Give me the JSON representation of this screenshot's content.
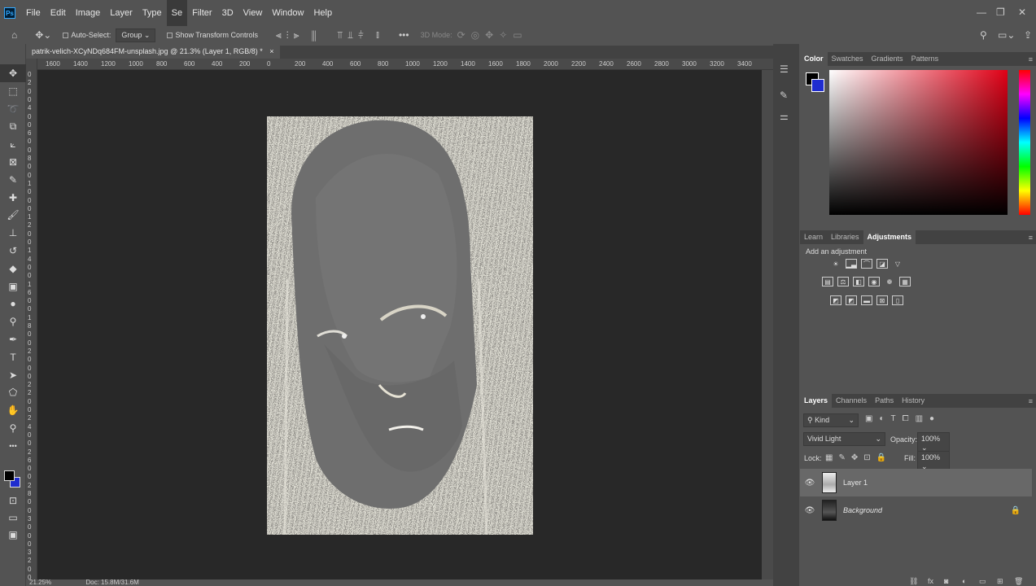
{
  "app": {
    "logo": "Ps"
  },
  "menu": [
    "File",
    "Edit",
    "Image",
    "Layer",
    "Type",
    "Se",
    "Filter",
    "3D",
    "View",
    "Window",
    "Help"
  ],
  "window_controls": {
    "minimize": "—",
    "restore": "❐",
    "close": "✕"
  },
  "options_bar": {
    "auto_select_label": "Auto-Select:",
    "auto_select_value": "Group",
    "show_transform_label": "Show Transform Controls",
    "mode_3d_label": "3D Mode:"
  },
  "document": {
    "tab_title": "patrik-velich-XCyNDq684FM-unsplash.jpg @ 21.3% (Layer 1, RGB/8) *",
    "close": "×"
  },
  "hruler_ticks": [
    "1600",
    "1400",
    "1200",
    "1000",
    "800",
    "600",
    "400",
    "200",
    "0",
    "200",
    "400",
    "600",
    "800",
    "1000",
    "1200",
    "1400",
    "1600",
    "1800",
    "2000",
    "2200",
    "2400",
    "2600",
    "2800",
    "3000",
    "3200",
    "3400"
  ],
  "vruler_ticks": [
    "0",
    "2",
    "0",
    "0",
    "4",
    "0",
    "0",
    "6",
    "0",
    "0",
    "8",
    "0",
    "0",
    "1",
    "0",
    "0",
    "0",
    "1",
    "2",
    "0",
    "0",
    "1",
    "4",
    "0",
    "0",
    "1",
    "6",
    "0",
    "0",
    "1",
    "8",
    "0",
    "0",
    "2",
    "0",
    "0",
    "0",
    "2",
    "2",
    "0",
    "0",
    "2",
    "4",
    "0",
    "0",
    "2",
    "6",
    "0",
    "0",
    "2",
    "8",
    "0",
    "0",
    "3",
    "0",
    "0",
    "0",
    "3",
    "2",
    "0",
    "0"
  ],
  "status": {
    "zoom": "21.25%",
    "doc": "Doc: 15.8M/31.6M"
  },
  "tools": [
    {
      "name": "move-tool",
      "glyph": "✥"
    },
    {
      "name": "marquee-tool",
      "glyph": "⬚"
    },
    {
      "name": "lasso-tool",
      "glyph": "➰"
    },
    {
      "name": "object-select-tool",
      "glyph": "⧉"
    },
    {
      "name": "crop-tool",
      "glyph": "⟀"
    },
    {
      "name": "frame-tool",
      "glyph": "⊠"
    },
    {
      "name": "eyedropper-tool",
      "glyph": "✎"
    },
    {
      "name": "healing-tool",
      "glyph": "✚"
    },
    {
      "name": "brush-tool",
      "glyph": "🖌"
    },
    {
      "name": "stamp-tool",
      "glyph": "⊥"
    },
    {
      "name": "history-brush-tool",
      "glyph": "↺"
    },
    {
      "name": "eraser-tool",
      "glyph": "◆"
    },
    {
      "name": "gradient-tool",
      "glyph": "▣"
    },
    {
      "name": "blur-tool",
      "glyph": "●"
    },
    {
      "name": "dodge-tool",
      "glyph": "⚲"
    },
    {
      "name": "pen-tool",
      "glyph": "✒"
    },
    {
      "name": "type-tool",
      "glyph": "T"
    },
    {
      "name": "path-select-tool",
      "glyph": "➤"
    },
    {
      "name": "shape-tool",
      "glyph": "⬠"
    },
    {
      "name": "hand-tool",
      "glyph": "✋"
    },
    {
      "name": "zoom-tool",
      "glyph": "⚲"
    },
    {
      "name": "more-tools",
      "glyph": "•••"
    }
  ],
  "colors": {
    "foreground": "#000000",
    "background": "#1f2ccf",
    "accent": "#e00016"
  },
  "color_panel": {
    "tabs": [
      "Color",
      "Swatches",
      "Gradients",
      "Patterns"
    ],
    "active": "Color"
  },
  "adjust_panel": {
    "tabs": [
      "Learn",
      "Libraries",
      "Adjustments"
    ],
    "active": "Adjustments",
    "caption": "Add an adjustment"
  },
  "layers_panel": {
    "tabs": [
      "Layers",
      "Channels",
      "Paths",
      "History"
    ],
    "kind": "Kind",
    "blend_mode": "Vivid Light",
    "opacity_label": "Opacity:",
    "opacity_value": "100%",
    "lock_label": "Lock:",
    "fill_label": "Fill:",
    "fill_value": "100%",
    "layers": [
      {
        "name": "Layer 1",
        "selected": true
      },
      {
        "name": "Background",
        "locked": true
      }
    ]
  }
}
